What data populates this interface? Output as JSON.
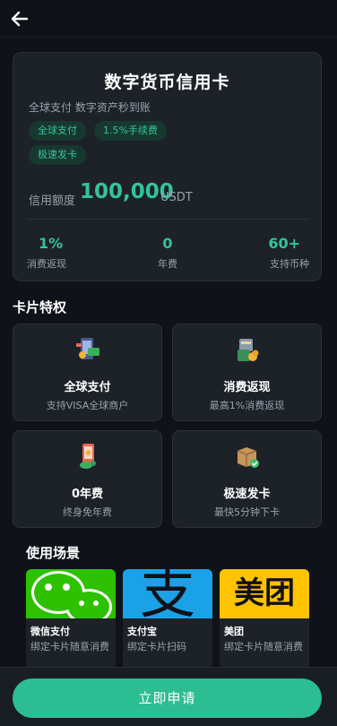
{
  "header": {
    "back_icon": "arrow-left-icon"
  },
  "hero": {
    "title": "数字货币信用卡",
    "subtitle": "全球支付 数字资产秒到账",
    "tags": [
      "全球支付",
      "1.5%手续费",
      "极速发卡"
    ],
    "limit_label": "信用额度",
    "limit_value": "100,000",
    "limit_unit": "USDT",
    "stats": [
      {
        "value": "1%",
        "label": "消费返现"
      },
      {
        "value": "0",
        "label": "年费"
      },
      {
        "value": "60+",
        "label": "支持币种"
      }
    ]
  },
  "features": {
    "title": "卡片特权",
    "items": [
      {
        "title": "全球支付",
        "desc": "支持VISA全球商户",
        "icon": "phone-payment-icon"
      },
      {
        "title": "消费返现",
        "desc": "最高1%消费返现",
        "icon": "money-bag-icon"
      },
      {
        "title": "0年费",
        "desc": "终身免年费",
        "icon": "phone-coin-icon"
      },
      {
        "title": "极速发卡",
        "desc": "最快5分钟下卡",
        "icon": "package-check-icon"
      }
    ]
  },
  "scenes": {
    "title": "使用场景",
    "items": [
      {
        "name": "微信支付",
        "desc": "绑定卡片随意消费",
        "icon": "wechat-icon",
        "color": "#2dc100"
      },
      {
        "name": "支付宝",
        "desc": "绑定卡片扫码",
        "icon": "alipay-icon",
        "color": "#1ba1e6",
        "logo_text": "支"
      },
      {
        "name": "美团",
        "desc": "绑定卡片随意消费",
        "icon": "meituan-icon",
        "color": "#ffc300",
        "logo_text": "美团"
      }
    ]
  },
  "footer": {
    "apply_label": "立即申请"
  },
  "colors": {
    "accent": "#2dbd93",
    "background": "#0f1218",
    "card": "#1d2229"
  }
}
